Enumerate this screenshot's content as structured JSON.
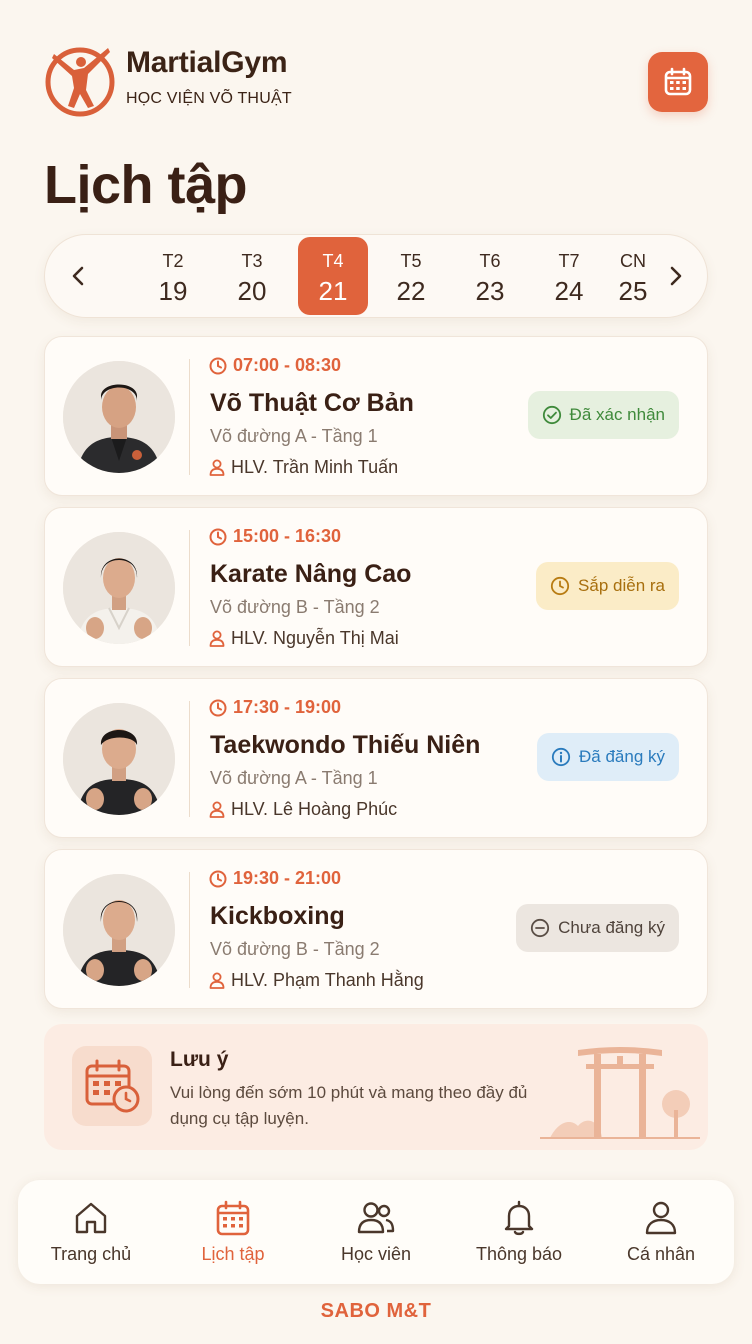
{
  "brand": {
    "name": "MartialGym",
    "subtitle": "HỌC VIỆN VÕ THUẬT"
  },
  "page_title": "Lịch tập",
  "week": {
    "days": [
      {
        "name": "T2",
        "date": "19"
      },
      {
        "name": "T3",
        "date": "20"
      },
      {
        "name": "T4",
        "date": "21"
      },
      {
        "name": "T5",
        "date": "22"
      },
      {
        "name": "T6",
        "date": "23"
      },
      {
        "name": "T7",
        "date": "24"
      },
      {
        "name": "CN",
        "date": "25"
      }
    ],
    "selected": "T4"
  },
  "classes": [
    {
      "time": "07:00 - 08:30",
      "name": "Võ Thuật Cơ Bản",
      "room": "Võ đường A - Tầng 1",
      "coach": "HLV. Trần Minh Tuấn",
      "status": "Đã xác nhận",
      "status_icon": "check-circle-icon",
      "status_color": "#3f8a3b"
    },
    {
      "time": "15:00 - 16:30",
      "name": "Karate Nâng Cao",
      "room": "Võ đường B - Tầng 2",
      "coach": "HLV. Nguyễn Thị Mai",
      "status": "Sắp diễn ra",
      "status_icon": "clock-icon",
      "status_color": "#b87c12"
    },
    {
      "time": "17:30 - 19:00",
      "name": "Taekwondo Thiếu Niên",
      "room": "Võ đường A - Tầng 1",
      "coach": "HLV. Lê Hoàng Phúc",
      "status": "Đã đăng ký",
      "status_icon": "info-icon",
      "status_color": "#2a7bbd"
    },
    {
      "time": "19:30 - 21:00",
      "name": "Kickboxing",
      "room": "Võ đường B - Tầng 2",
      "coach": "HLV. Phạm Thanh Hằng",
      "status": "Chưa đăng ký",
      "status_icon": "minus-circle-icon",
      "status_color": "#5a4e46"
    }
  ],
  "note": {
    "title": "Lưu ý",
    "text": "Vui lòng đến sớm 10 phút và mang theo đầy đủ dụng cụ tập luyện."
  },
  "nav": [
    {
      "label": "Trang chủ",
      "icon": "home-icon"
    },
    {
      "label": "Lịch tập",
      "icon": "calendar-icon"
    },
    {
      "label": "Học viên",
      "icon": "users-icon"
    },
    {
      "label": "Thông báo",
      "icon": "bell-icon"
    },
    {
      "label": "Cá nhân",
      "icon": "user-icon"
    }
  ],
  "nav_active": "Lịch tập",
  "footer": "SABO M&T",
  "colors": {
    "accent": "#e0633c",
    "background": "#fbf6ef",
    "text_dark": "#3a2015"
  }
}
